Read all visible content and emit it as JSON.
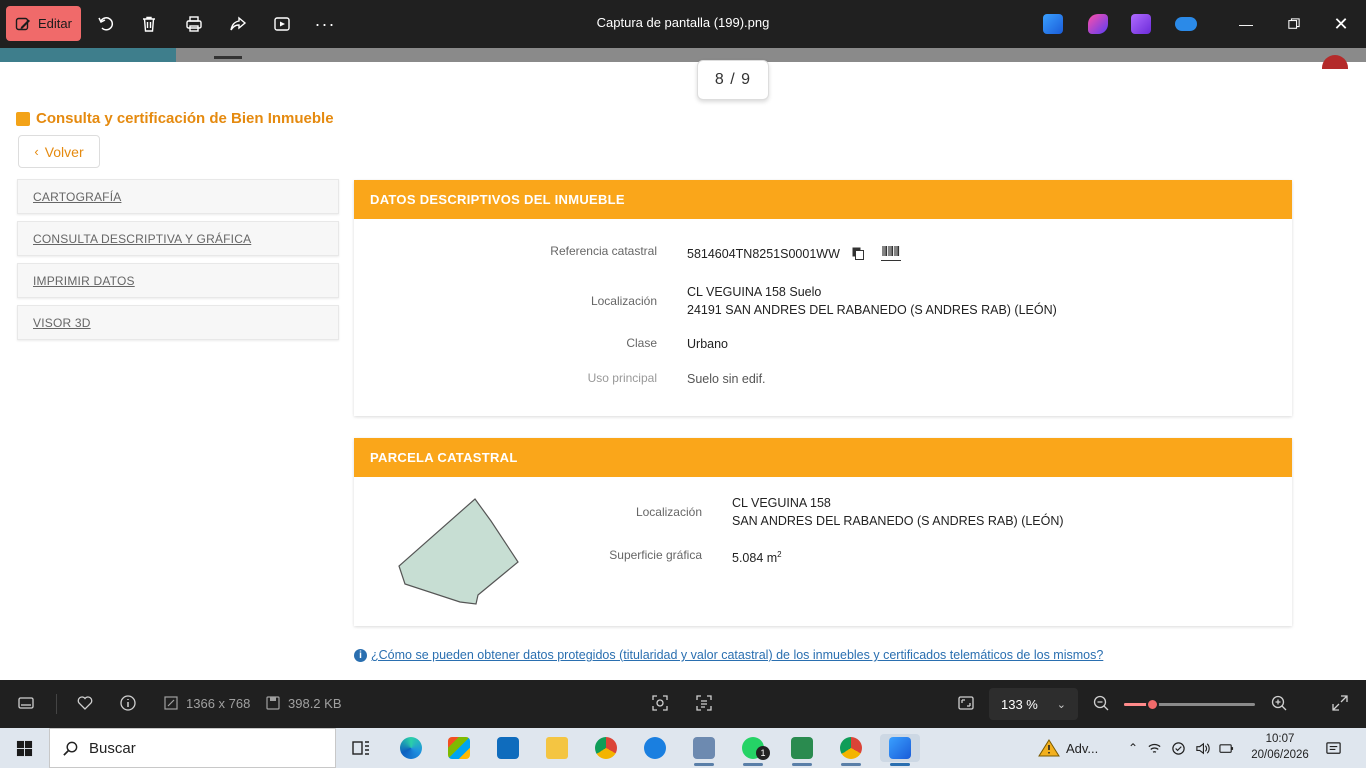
{
  "app": {
    "edit_label": "Editar",
    "title": "Captura de pantalla (199).png"
  },
  "page": {
    "page_indicator": "8 / 9",
    "heading": "Consulta y certificación de Bien Inmueble",
    "back_label": "Volver",
    "sidebar": [
      {
        "label": "CARTOGRAFÍA"
      },
      {
        "label": "CONSULTA DESCRIPTIVA Y GRÁFICA"
      },
      {
        "label": "IMPRIMIR DATOS"
      },
      {
        "label": "VISOR 3D"
      }
    ],
    "descriptive": {
      "title": "DATOS DESCRIPTIVOS DEL INMUEBLE",
      "ref_label": "Referencia catastral",
      "ref_value": "5814604TN8251S0001WW",
      "loc_label": "Localización",
      "loc_line1": "CL VEGUINA 158 Suelo",
      "loc_line2": "24191 SAN ANDRES DEL RABANEDO (S ANDRES RAB) (LEÓN)",
      "class_label": "Clase",
      "class_value": "Urbano",
      "use_label": "Uso principal",
      "use_value": "Suelo sin edif."
    },
    "parcel": {
      "title": "PARCELA CATASTRAL",
      "loc_label": "Localización",
      "loc_line1": "CL VEGUINA 158",
      "loc_line2": "SAN ANDRES DEL RABANEDO (S ANDRES RAB) (LEÓN)",
      "area_label": "Superficie gráfica",
      "area_value": "5.084 m",
      "area_unit_sup": "2"
    },
    "help_text": "¿Cómo se pueden obtener datos protegidos (titularidad y valor catastral) de los inmuebles y certificados telemáticos de los mismos?"
  },
  "viewer_bar": {
    "dimensions": "1366 x 768",
    "file_size": "398.2 KB",
    "zoom": "133 %",
    "zoom_level": 0.22
  },
  "taskbar": {
    "search_label": "Buscar",
    "weather_text": "Adv...",
    "time": "10:07",
    "date": "20/06/2026",
    "whatsapp_badge": "1"
  }
}
